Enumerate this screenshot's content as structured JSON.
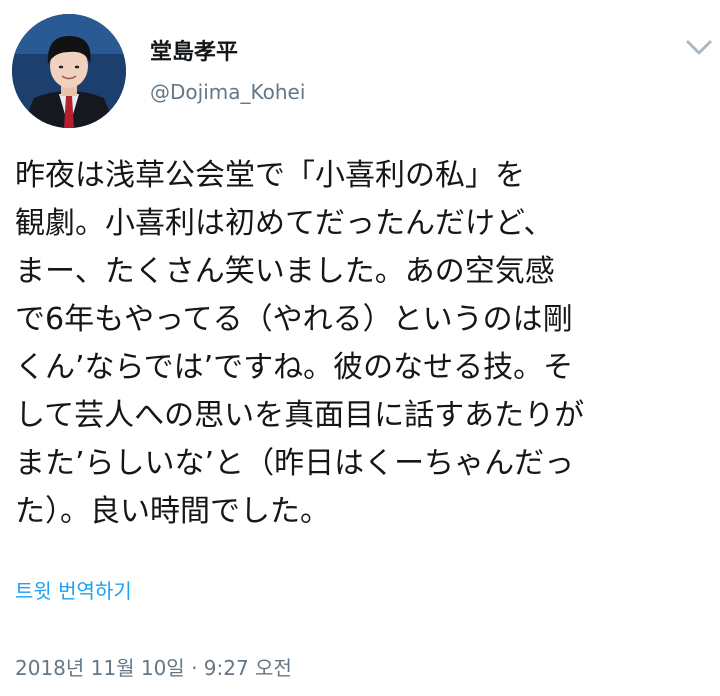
{
  "author": {
    "display_name": "堂島孝平",
    "handle": "@Dojima_Kohei"
  },
  "tweet": {
    "lines": [
      "昨夜は浅草公会堂で「小喜利の私」を",
      "観劇。小喜利は初めてだったんだけど、",
      "まー、たくさん笑いました。あの空気感",
      "で6年もやってる（やれる）というのは剛",
      "くん’ならでは’ですね。彼のなせる技。そ",
      "して芸人への思いを真面目に話すあたりが",
      "また’らしいな’と（昨日はくーちゃんだっ",
      "た）。良い時間でした。"
    ]
  },
  "translate_label": "트윗 번역하기",
  "timestamp": "2018년 11월 10일 · 9:27 오전",
  "icons": {
    "menu": "chevron-down-icon",
    "avatar": "profile-photo"
  },
  "colors": {
    "text": "#14171a",
    "secondary": "#657786",
    "link": "#1da1f2",
    "chevron": "#aab8c2"
  }
}
